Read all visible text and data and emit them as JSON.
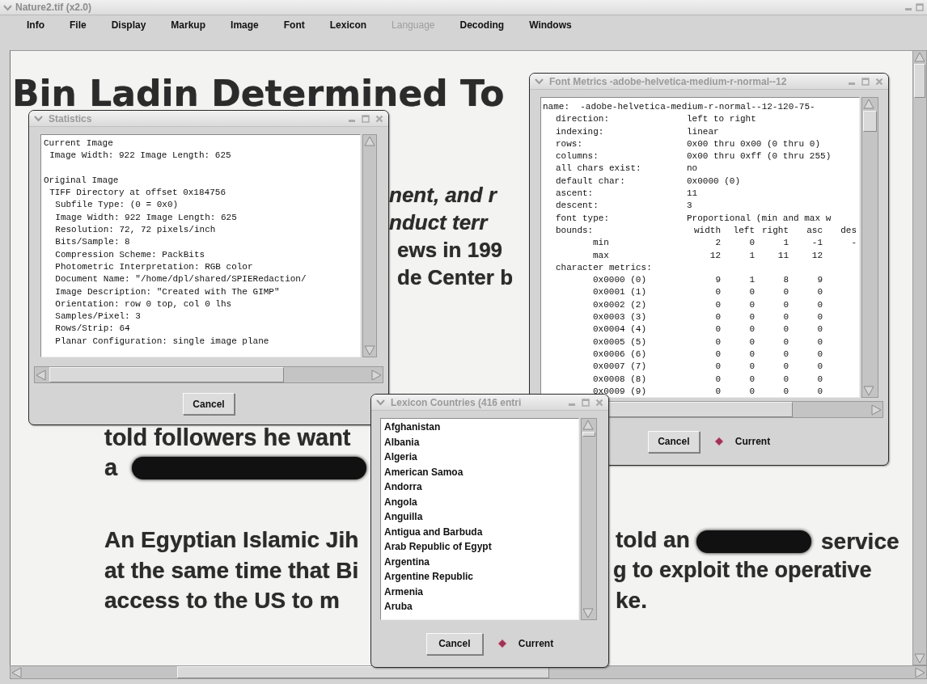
{
  "window": {
    "title": "Nature2.tif (x2.0)"
  },
  "menu": [
    {
      "label": "Info",
      "disabled": false
    },
    {
      "label": "File",
      "disabled": false
    },
    {
      "label": "Display",
      "disabled": false
    },
    {
      "label": "Markup",
      "disabled": false
    },
    {
      "label": "Image",
      "disabled": false
    },
    {
      "label": "Font",
      "disabled": false
    },
    {
      "label": "Lexicon",
      "disabled": false
    },
    {
      "label": "Language",
      "disabled": true
    },
    {
      "label": "Decoding",
      "disabled": false
    },
    {
      "label": "Windows",
      "disabled": false
    }
  ],
  "document": {
    "fragments": [
      {
        "kind": "heading",
        "text": "Bin Ladin Determined To"
      },
      {
        "kind": "text",
        "text": "nent, and r"
      },
      {
        "kind": "text",
        "text": "nduct terr"
      },
      {
        "kind": "text",
        "text": "ews in 199"
      },
      {
        "kind": "text",
        "text": "de Center b"
      },
      {
        "kind": "text",
        "text": "told followers he want"
      },
      {
        "kind": "text",
        "text": "a"
      },
      {
        "kind": "redaction"
      },
      {
        "kind": "text",
        "text": "An Egyptian Islamic Jih"
      },
      {
        "kind": "text",
        "text": "told an"
      },
      {
        "kind": "redaction"
      },
      {
        "kind": "text",
        "text": "service"
      },
      {
        "kind": "text",
        "text": "at the same time that Bi"
      },
      {
        "kind": "text",
        "text": "g to exploit the operative"
      },
      {
        "kind": "text",
        "text": "access to the US to m"
      },
      {
        "kind": "text",
        "text": "ke."
      }
    ]
  },
  "statistics": {
    "title": "Statistics",
    "lines": [
      {
        "text": "Current Image",
        "children": [
          {
            "text": "Image Width: 922 Image Length: 625"
          }
        ]
      },
      {
        "text": "Original Image",
        "children": [
          {
            "text": "TIFF Directory at offset 0x184756",
            "children": [
              {
                "text": "Subfile Type: (0 = 0x0)"
              },
              {
                "text": "Image Width: 922 Image Length: 625"
              },
              {
                "text": "Resolution: 72, 72 pixels/inch"
              },
              {
                "text": "Bits/Sample: 8"
              },
              {
                "text": "Compression Scheme: PackBits"
              },
              {
                "text": "Photometric Interpretation: RGB color"
              },
              {
                "text": "Document Name: \"/home/dpl/shared/SPIERedaction/"
              },
              {
                "text": "Image Description: \"Created with The GIMP\""
              },
              {
                "text": "Orientation: row 0 top, col 0 lhs"
              },
              {
                "text": "Samples/Pixel: 3"
              },
              {
                "text": "Rows/Strip: 64"
              },
              {
                "text": "Planar Configuration: single image plane"
              }
            ]
          }
        ]
      }
    ],
    "button": "Cancel"
  },
  "font_metrics": {
    "title": "Font Metrics -adobe-helvetica-medium-r-normal--12",
    "entries": [
      {
        "label": "name:",
        "value": "-adobe-helvetica-medium-r-normal--12-120-75-",
        "children": [
          {
            "label": "direction:",
            "value": "left to right"
          },
          {
            "label": "indexing:",
            "value": "linear"
          },
          {
            "label": "rows:",
            "value": "0x00 thru 0x00 (0 thru 0)"
          },
          {
            "label": "columns:",
            "value": "0x00 thru 0xff (0 thru 255)"
          },
          {
            "label": "all chars exist:",
            "value": "no"
          },
          {
            "label": "default char:",
            "value": "0x0000 (0)"
          },
          {
            "label": "ascent:",
            "value": "11"
          },
          {
            "label": "descent:",
            "value": "3"
          },
          {
            "label": "font type:",
            "value": "Proportional (min and max w"
          },
          {
            "label": "bounds:",
            "columns": [
              "width",
              "left",
              "right",
              "asc",
              "des"
            ],
            "children": [
              {
                "label": "min",
                "columns": [
                  "2",
                  "0",
                  "1",
                  "-1",
                  "-"
                ]
              },
              {
                "label": "max",
                "columns": [
                  "12",
                  "1",
                  "11",
                  "12"
                ]
              }
            ]
          },
          {
            "label": "character metrics:",
            "children": [
              {
                "label": "0x0000 (0)",
                "columns": [
                  "9",
                  "1",
                  "8",
                  "9"
                ]
              },
              {
                "label": "0x0001 (1)",
                "columns": [
                  "0",
                  "0",
                  "0",
                  "0"
                ]
              },
              {
                "label": "0x0002 (2)",
                "columns": [
                  "0",
                  "0",
                  "0",
                  "0"
                ]
              },
              {
                "label": "0x0003 (3)",
                "columns": [
                  "0",
                  "0",
                  "0",
                  "0"
                ]
              },
              {
                "label": "0x0004 (4)",
                "columns": [
                  "0",
                  "0",
                  "0",
                  "0"
                ]
              },
              {
                "label": "0x0005 (5)",
                "columns": [
                  "0",
                  "0",
                  "0",
                  "0"
                ]
              },
              {
                "label": "0x0006 (6)",
                "columns": [
                  "0",
                  "0",
                  "0",
                  "0"
                ]
              },
              {
                "label": "0x0007 (7)",
                "columns": [
                  "0",
                  "0",
                  "0",
                  "0"
                ]
              },
              {
                "label": "0x0008 (8)",
                "columns": [
                  "0",
                  "0",
                  "0",
                  "0"
                ]
              },
              {
                "label": "0x0009 (9)",
                "columns": [
                  "0",
                  "0",
                  "0",
                  "0"
                ]
              }
            ]
          }
        ]
      }
    ],
    "button": "Cancel",
    "radio": {
      "label": "Current",
      "selected": true
    }
  },
  "lexicon": {
    "title": "Lexicon Countries (416 entri",
    "items": [
      "Afghanistan",
      "Albania",
      "Algeria",
      "American Samoa",
      "Andorra",
      "Angola",
      "Anguilla",
      "Antigua and Barbuda",
      "Arab Republic of Egypt",
      "Argentina",
      "Argentine Republic",
      "Armenia",
      "Aruba"
    ],
    "button": "Cancel",
    "radio": {
      "label": "Current",
      "selected": true
    }
  }
}
